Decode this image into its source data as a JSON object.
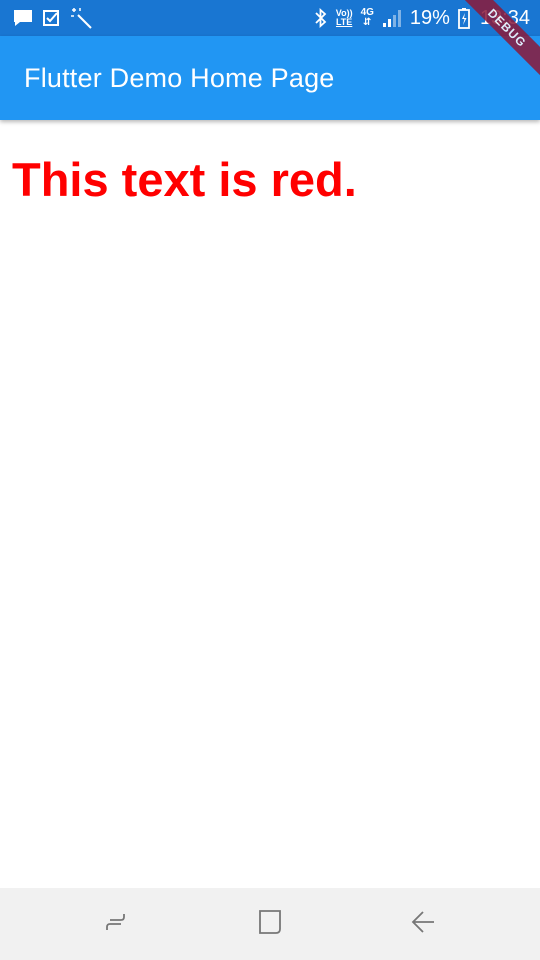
{
  "status_bar": {
    "left_icons": [
      "message-icon",
      "checkbox-icon",
      "magic-wand-icon"
    ],
    "volte_top": "Vo))",
    "volte_bottom": "LTE",
    "network_type": "4G",
    "network_arrows": "⇵",
    "battery_percent": "19%",
    "time": "13:34"
  },
  "app_bar": {
    "title": "Flutter Demo Home Page",
    "color": "#2196f3"
  },
  "debug_banner": {
    "label": "DEBUG"
  },
  "body": {
    "text": "This text is red.",
    "text_color": "#ff0000"
  },
  "nav_bar": {
    "buttons": [
      "recent-apps-icon",
      "home-icon",
      "back-icon"
    ]
  }
}
